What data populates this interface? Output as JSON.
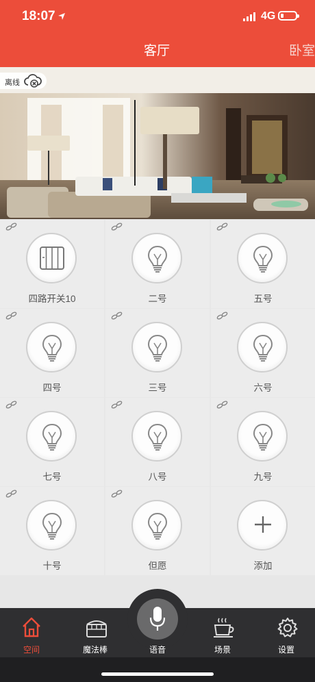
{
  "status_bar": {
    "time": "18:07",
    "network": "4G"
  },
  "header": {
    "active_tab": "客厅",
    "next_tab": "卧室"
  },
  "room": {
    "status_label": "离线"
  },
  "devices": [
    {
      "label": "四路开关10",
      "icon": "switch-panel-icon"
    },
    {
      "label": "二号",
      "icon": "bulb-icon"
    },
    {
      "label": "五号",
      "icon": "bulb-icon"
    },
    {
      "label": "四号",
      "icon": "bulb-icon"
    },
    {
      "label": "三号",
      "icon": "bulb-icon"
    },
    {
      "label": "六号",
      "icon": "bulb-icon"
    },
    {
      "label": "七号",
      "icon": "bulb-icon"
    },
    {
      "label": "八号",
      "icon": "bulb-icon"
    },
    {
      "label": "九号",
      "icon": "bulb-icon"
    },
    {
      "label": "十号",
      "icon": "bulb-icon"
    },
    {
      "label": "但愿",
      "icon": "bulb-icon"
    },
    {
      "label": "添加",
      "icon": "plus-icon"
    }
  ],
  "nav": {
    "items": [
      {
        "label": "空间",
        "icon": "home-icon",
        "active": true
      },
      {
        "label": "魔法棒",
        "icon": "wand-box-icon",
        "active": false
      },
      {
        "label": "语音",
        "icon": "microphone-icon",
        "active": false
      },
      {
        "label": "场景",
        "icon": "coffee-cup-icon",
        "active": false
      },
      {
        "label": "设置",
        "icon": "gear-icon",
        "active": false
      }
    ]
  },
  "colors": {
    "accent": "#ec4d3a",
    "nav_bg": "#2f2f31",
    "tile_bg": "#ececec"
  }
}
